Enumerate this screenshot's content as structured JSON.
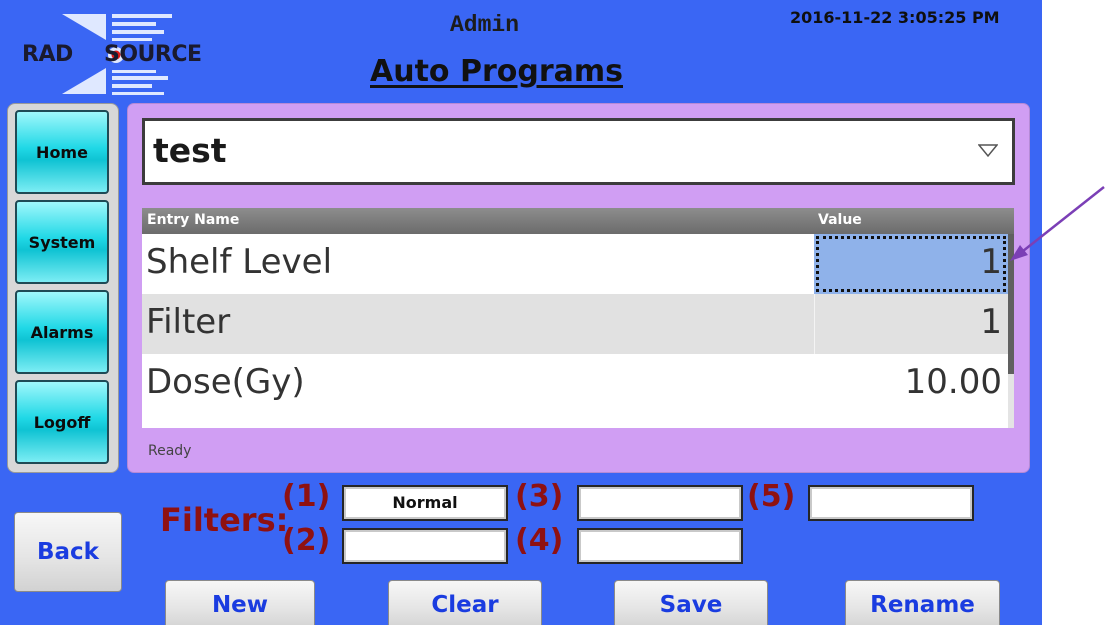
{
  "header": {
    "logo": {
      "word_left": "RAD",
      "word_right": "SOURCE"
    },
    "user_role": "Admin",
    "timestamp": "2016-11-22 3:05:25 PM",
    "page_title": "Auto Programs"
  },
  "nav": {
    "items": [
      {
        "label": "Home"
      },
      {
        "label": "System"
      },
      {
        "label": "Alarms"
      },
      {
        "label": "Logoff"
      }
    ],
    "back_label": "Back"
  },
  "program_select": {
    "value": "test",
    "icon": "chevron-down-icon"
  },
  "grid": {
    "columns": [
      "Entry Name",
      "Value"
    ],
    "rows": [
      {
        "name": "Shelf Level",
        "value": "1",
        "selected": true
      },
      {
        "name": "Filter",
        "value": "1"
      },
      {
        "name": "Dose(Gy)",
        "value": "10.00"
      }
    ]
  },
  "status": "Ready",
  "filters": {
    "label": "Filters:",
    "slots": [
      {
        "number": "(1)",
        "value": "Normal"
      },
      {
        "number": "(2)",
        "value": ""
      },
      {
        "number": "(3)",
        "value": ""
      },
      {
        "number": "(4)",
        "value": ""
      },
      {
        "number": "(5)",
        "value": ""
      }
    ]
  },
  "actions": {
    "new_label": "New",
    "clear_label": "Clear",
    "save_label": "Save",
    "rename_label": "Rename"
  },
  "colors": {
    "background": "#3a66f4",
    "panel": "#d09ef3",
    "nav_button": "#20d8e6",
    "filter_text": "#8f1111",
    "action_text": "#1a3ce0",
    "selection": "#8fb2ea",
    "annotation_arrow": "#7b3fb6"
  }
}
